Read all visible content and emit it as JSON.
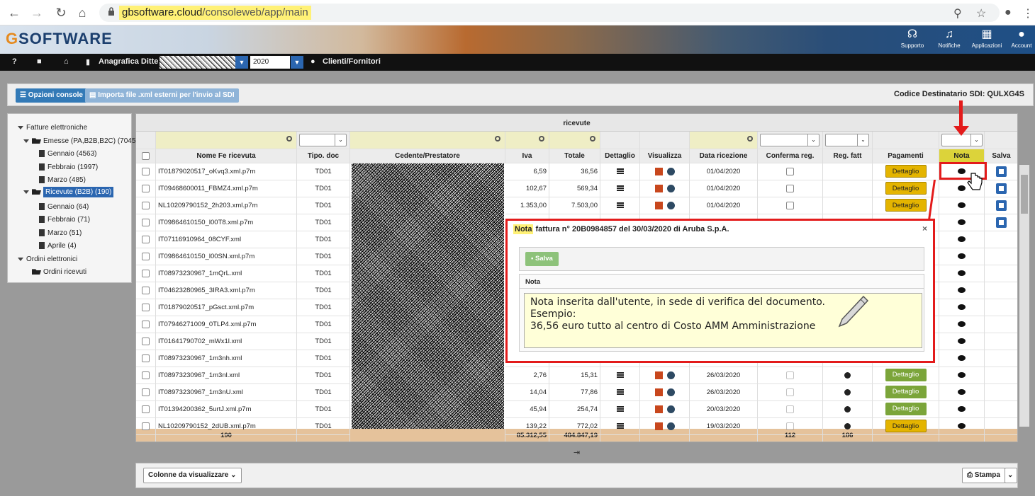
{
  "browser": {
    "url_host": "gbsoftware.cloud",
    "url_path": "/consoleweb/app/main"
  },
  "app": {
    "logo": "SOFTWARE",
    "header_buttons": [
      "Supporto",
      "Notifiche",
      "Applicazioni",
      "Account"
    ],
    "toolbar": {
      "anagrafica": "Anagrafica Ditte",
      "year": "2020",
      "clienti": "Clienti/Fornitori"
    }
  },
  "console": {
    "opzioni": "Opzioni console",
    "importa": "Importa file .xml esterni per l'invio al SDI",
    "sdi": "Codice Destinatario SDI: QULXG4S"
  },
  "tree": [
    {
      "label": "Fatture elettroniche"
    },
    {
      "label": "Emesse (PA,B2B,B2C) (7045)"
    },
    {
      "label": "Gennaio (4563)"
    },
    {
      "label": "Febbraio (1997)"
    },
    {
      "label": "Marzo (485)"
    },
    {
      "label": "Ricevute (B2B) (190)"
    },
    {
      "label": "Gennaio (64)"
    },
    {
      "label": "Febbraio (71)"
    },
    {
      "label": "Marzo (51)"
    },
    {
      "label": "Aprile (4)"
    },
    {
      "label": "Ordini elettronici"
    },
    {
      "label": "Ordini ricevuti"
    }
  ],
  "grid": {
    "caption": "ricevute",
    "columns": [
      "Nome Fe ricevuta",
      "Tipo. doc",
      "Cedente/Prestatore",
      "Iva",
      "Totale",
      "Dettaglio",
      "Visualizza",
      "Data ricezione",
      "Conferma reg.",
      "Reg. fatt",
      "Pagamenti",
      "Nota",
      "Salva"
    ],
    "rows": [
      {
        "nome": "IT01879020517_oKvq3.xml.p7m",
        "tipo": "TD01",
        "iva": "6,59",
        "totale": "36,56",
        "data": "01/04/2020",
        "pag": "Dettaglio",
        "pagc": "yel",
        "reg": false,
        "save": true
      },
      {
        "nome": "IT09468600011_FBMZ4.xml.p7m",
        "tipo": "TD01",
        "iva": "102,67",
        "totale": "569,34",
        "data": "01/04/2020",
        "pag": "Dettaglio",
        "pagc": "yel",
        "reg": false,
        "save": true
      },
      {
        "nome": "NL10209790152_2h203.xml.p7m",
        "tipo": "TD01",
        "iva": "1.353,00",
        "totale": "7.503,00",
        "data": "01/04/2020",
        "pag": "Dettaglio",
        "pagc": "yel",
        "reg": false,
        "save": true
      },
      {
        "nome": "IT09864610150_l00T8.xml.p7m",
        "tipo": "TD01",
        "iva": "",
        "totale": "",
        "data": "",
        "pag": "",
        "pagc": "",
        "reg": false,
        "save": true
      },
      {
        "nome": "IT07116910964_08CYF.xml",
        "tipo": "TD01",
        "iva": "",
        "totale": "",
        "data": "",
        "pag": "",
        "pagc": "",
        "reg": false,
        "save": false
      },
      {
        "nome": "IT09864610150_l00SN.xml.p7m",
        "tipo": "TD01",
        "iva": "",
        "totale": "",
        "data": "",
        "pag": "",
        "pagc": "",
        "reg": false,
        "save": false
      },
      {
        "nome": "IT08973230967_1mQrL.xml",
        "tipo": "TD01",
        "iva": "",
        "totale": "",
        "data": "",
        "pag": "",
        "pagc": "",
        "reg": false,
        "save": false
      },
      {
        "nome": "IT04623280965_3IRA3.xml.p7m",
        "tipo": "TD01",
        "iva": "",
        "totale": "",
        "data": "",
        "pag": "",
        "pagc": "",
        "reg": false,
        "save": false
      },
      {
        "nome": "IT01879020517_pGsct.xml.p7m",
        "tipo": "TD01",
        "iva": "",
        "totale": "",
        "data": "",
        "pag": "",
        "pagc": "",
        "reg": false,
        "save": false
      },
      {
        "nome": "IT07946271009_0TLP4.xml.p7m",
        "tipo": "TD01",
        "iva": "",
        "totale": "",
        "data": "",
        "pag": "",
        "pagc": "",
        "reg": false,
        "save": false
      },
      {
        "nome": "IT01641790702_mWx1l.xml",
        "tipo": "TD01",
        "iva": "",
        "totale": "",
        "data": "",
        "pag": "",
        "pagc": "",
        "reg": false,
        "save": false
      },
      {
        "nome": "IT08973230967_1m3nh.xml",
        "tipo": "TD01",
        "iva": "",
        "totale": "",
        "data": "",
        "pag": "",
        "pagc": "",
        "reg": false,
        "save": false
      },
      {
        "nome": "IT08973230967_1m3nl.xml",
        "tipo": "TD01",
        "iva": "2,76",
        "totale": "15,31",
        "data": "26/03/2020",
        "pag": "Dettaglio",
        "pagc": "grn",
        "reg": true,
        "save": false
      },
      {
        "nome": "IT08973230967_1m3nU.xml",
        "tipo": "TD01",
        "iva": "14,04",
        "totale": "77,86",
        "data": "26/03/2020",
        "pag": "Dettaglio",
        "pagc": "grn",
        "reg": true,
        "save": false
      },
      {
        "nome": "IT01394200362_5urtJ.xml.p7m",
        "tipo": "TD01",
        "iva": "45,94",
        "totale": "254,74",
        "data": "20/03/2020",
        "pag": "Dettaglio",
        "pagc": "grn",
        "reg": true,
        "save": false
      },
      {
        "nome": "NL10209790152_2dUB.xml.p7m",
        "tipo": "TD01",
        "iva": "139,22",
        "totale": "772,02",
        "data": "19/03/2020",
        "pag": "Dettaglio",
        "pagc": "yel",
        "reg": true,
        "save": false
      }
    ],
    "totals": {
      "count": "190",
      "iva": "85.312,55",
      "totale": "484.847,19",
      "conferma": "112",
      "reg": "186"
    }
  },
  "bottom": {
    "colonne": "Colonne da visualizzare",
    "stampa": "Stampa",
    "pager": "⇥"
  },
  "modal": {
    "title_hl": "Nota",
    "title": " fattura n° 20B0984857 del 30/03/2020 di Aruba S.p.A.",
    "close": "×",
    "save": "Salva",
    "panel": "Nota",
    "text": "Nota inserita dall'utente, in sede di verifica del documento.\nEsempio:\n36,56 euro tutto al centro di Costo AMM Amministrazione"
  }
}
